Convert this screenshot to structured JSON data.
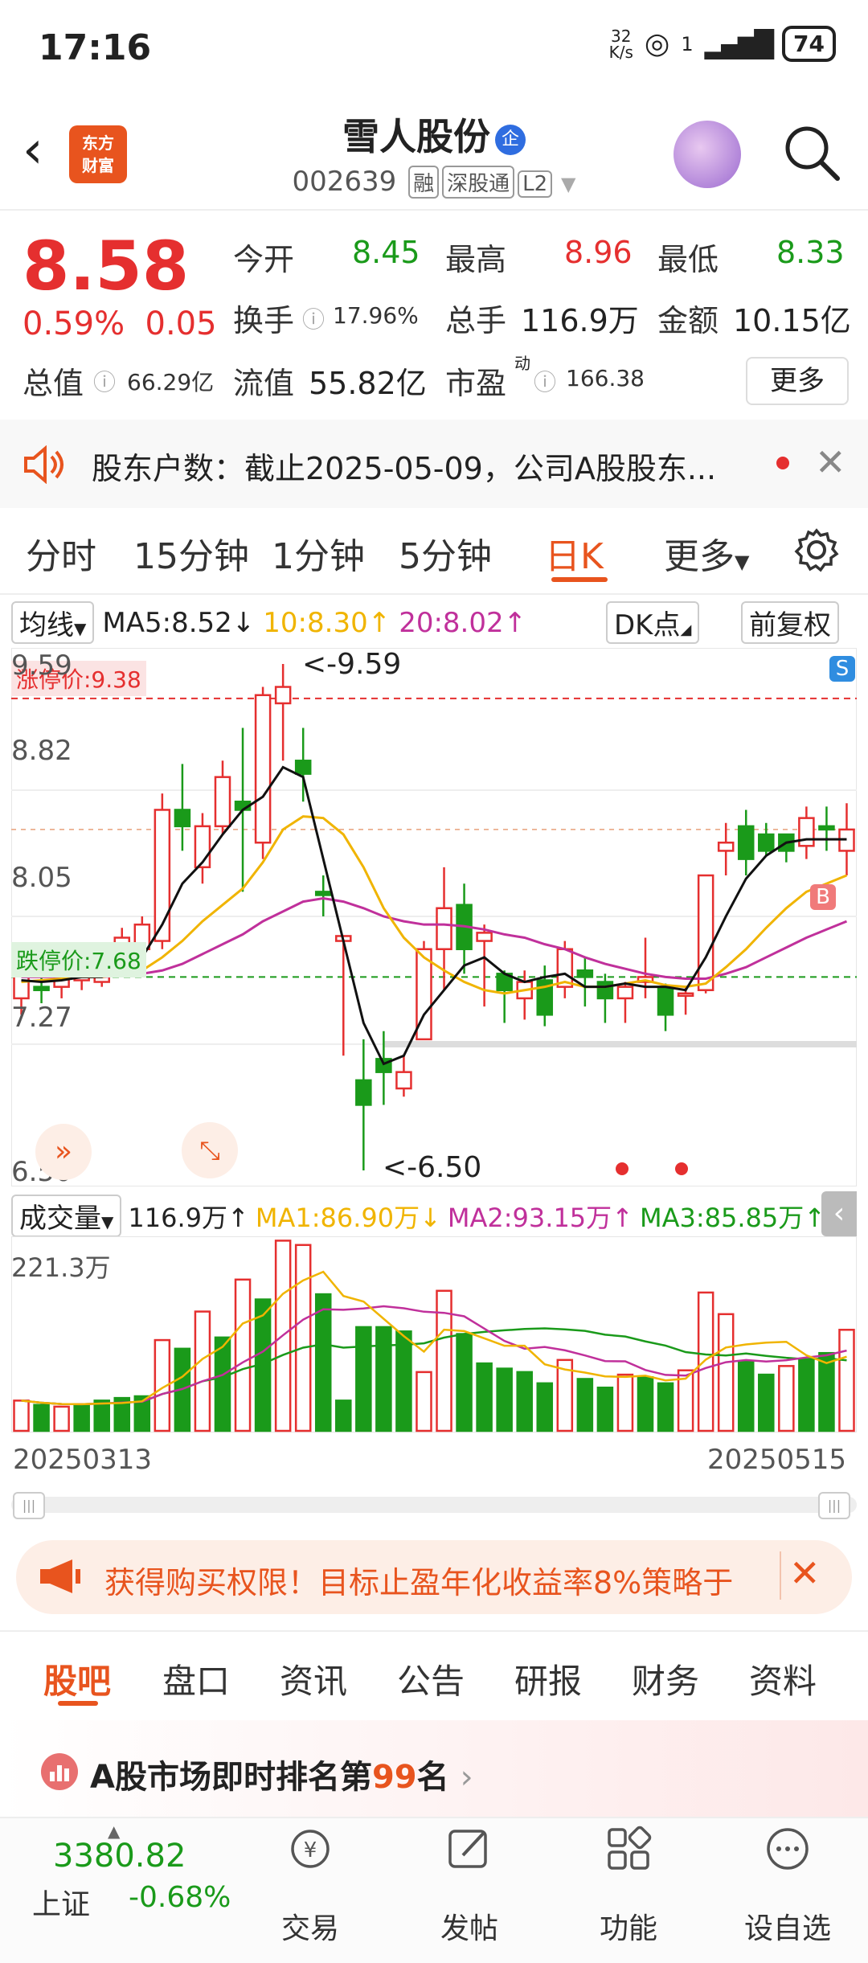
{
  "status_bar": {
    "time": "17:16",
    "net_speed": "32\nK/s",
    "signal_num": "1",
    "battery": "74"
  },
  "header": {
    "stock_name": "雪人股份",
    "badge": "企",
    "code": "002639",
    "tags": [
      "融",
      "深股通",
      "L2"
    ],
    "logo": "东方\n财富"
  },
  "quote": {
    "price": "8.58",
    "change_pct": "0.59%",
    "change_amt": "0.05",
    "open_label": "今开",
    "open": "8.45",
    "high_label": "最高",
    "high": "8.96",
    "low_label": "最低",
    "low": "8.33",
    "turnover_label": "换手",
    "turnover": "17.96%",
    "volume_label": "总手",
    "volume": "116.9万",
    "amount_label": "金额",
    "amount": "10.15亿",
    "mktcap_label": "总值",
    "mktcap": "66.29亿",
    "float_label": "流值",
    "float": "55.82亿",
    "pe_label": "市盈",
    "pe_sup": "动",
    "pe": "166.38",
    "more": "更多"
  },
  "notice": {
    "text": "股东户数：截止2025-05-09，公司A股股东..."
  },
  "chart_tabs": [
    "分时",
    "15分钟",
    "1分钟",
    "5分钟",
    "日K",
    "更多"
  ],
  "ma_row": {
    "selector": "均线",
    "ma5": "MA5:8.52",
    "ma10": "10:8.30",
    "ma20": "20:8.02",
    "dk": "DK点",
    "adjust": "前复权"
  },
  "kchart": {
    "limit_up_label": "涨停价:9.38",
    "limit_down_label": "跌停价:7.68",
    "hi_label": "<-9.59",
    "lo_label": "<-6.50",
    "y_labels": [
      "9.59",
      "8.82",
      "8.05",
      "7.27",
      "6.50"
    ],
    "s_mark": "S",
    "b_mark": "B"
  },
  "volume_row": {
    "selector": "成交量",
    "vol": "116.9万",
    "ma1": "MA1:86.90万",
    "ma2": "MA2:93.15万",
    "ma3": "MA3:85.85万",
    "max_label": "221.3万"
  },
  "dates": {
    "start": "20250313",
    "end": "20250515"
  },
  "promo": {
    "text": "获得购买权限！目标止盈年化收益率8%策略于"
  },
  "bottom_tabs": [
    "股吧",
    "盘口",
    "资讯",
    "公告",
    "研报",
    "财务",
    "资料"
  ],
  "rank": {
    "prefix": "A股市场即时排名第",
    "num": "99",
    "suffix": "名"
  },
  "index": {
    "value": "3380.82",
    "name": "上证",
    "change": "-0.68%"
  },
  "nav": [
    "交易",
    "发帖",
    "功能",
    "设自选"
  ],
  "chart_data": {
    "type": "candlestick",
    "ylim": [
      6.5,
      9.59
    ],
    "candles": [
      [
        7.55,
        7.75,
        7.45,
        7.68
      ],
      [
        7.62,
        7.6,
        7.52,
        7.7
      ],
      [
        7.62,
        7.7,
        7.55,
        7.72
      ],
      [
        7.66,
        7.72,
        7.6,
        7.76
      ],
      [
        7.65,
        7.75,
        7.62,
        7.8
      ],
      [
        7.78,
        7.92,
        7.7,
        7.98
      ],
      [
        7.85,
        8.0,
        7.72,
        8.05
      ],
      [
        7.9,
        8.7,
        7.85,
        8.8
      ],
      [
        8.7,
        8.6,
        8.45,
        8.98
      ],
      [
        8.35,
        8.6,
        8.25,
        8.68
      ],
      [
        8.6,
        8.9,
        8.55,
        9.0
      ],
      [
        8.75,
        8.7,
        8.2,
        9.2
      ],
      [
        8.5,
        9.4,
        8.4,
        9.45
      ],
      [
        9.35,
        9.45,
        9.0,
        9.59
      ],
      [
        9.0,
        8.92,
        8.75,
        9.2
      ],
      [
        8.2,
        8.18,
        8.05,
        8.3
      ],
      [
        7.9,
        7.93,
        7.2,
        7.92
      ],
      [
        7.05,
        6.9,
        6.5,
        7.3
      ],
      [
        7.18,
        7.1,
        6.9,
        7.35
      ],
      [
        7.0,
        7.1,
        6.95,
        7.2
      ],
      [
        7.3,
        7.85,
        7.3,
        7.9
      ],
      [
        7.85,
        8.1,
        7.6,
        8.35
      ],
      [
        8.12,
        7.85,
        7.7,
        8.25
      ],
      [
        7.9,
        7.95,
        7.5,
        8.0
      ],
      [
        7.7,
        7.6,
        7.4,
        7.72
      ],
      [
        7.55,
        7.65,
        7.42,
        7.72
      ],
      [
        7.66,
        7.45,
        7.38,
        7.75
      ],
      [
        7.62,
        7.85,
        7.55,
        7.9
      ],
      [
        7.72,
        7.68,
        7.5,
        7.8
      ],
      [
        7.65,
        7.55,
        7.4,
        7.7
      ],
      [
        7.55,
        7.62,
        7.4,
        7.65
      ],
      [
        7.65,
        7.68,
        7.55,
        7.92
      ],
      [
        7.62,
        7.45,
        7.35,
        7.64
      ],
      [
        7.58,
        7.58,
        7.45,
        7.62
      ],
      [
        7.6,
        8.3,
        7.58,
        8.3
      ],
      [
        8.45,
        8.5,
        8.3,
        8.62
      ],
      [
        8.6,
        8.4,
        8.3,
        8.7
      ],
      [
        8.55,
        8.45,
        8.42,
        8.62
      ],
      [
        8.55,
        8.45,
        8.38,
        8.55
      ],
      [
        8.48,
        8.65,
        8.4,
        8.72
      ],
      [
        8.6,
        8.58,
        8.45,
        8.72
      ],
      [
        8.45,
        8.58,
        8.3,
        8.74
      ]
    ],
    "ma5": [
      7.66,
      7.65,
      7.66,
      7.68,
      7.68,
      7.74,
      7.8,
      8.0,
      8.25,
      8.38,
      8.55,
      8.7,
      8.78,
      8.96,
      8.9,
      8.4,
      7.9,
      7.4,
      7.15,
      7.2,
      7.45,
      7.6,
      7.75,
      7.8,
      7.7,
      7.65,
      7.68,
      7.7,
      7.62,
      7.62,
      7.64,
      7.62,
      7.62,
      7.6,
      7.8,
      8.05,
      8.28,
      8.42,
      8.5,
      8.52,
      8.52,
      8.52
    ],
    "ma10": [
      7.65,
      7.66,
      7.67,
      7.68,
      7.68,
      7.7,
      7.72,
      7.8,
      7.9,
      8.02,
      8.12,
      8.22,
      8.38,
      8.58,
      8.66,
      8.65,
      8.55,
      8.35,
      8.1,
      7.92,
      7.8,
      7.72,
      7.65,
      7.6,
      7.58,
      7.6,
      7.62,
      7.65,
      7.62,
      7.62,
      7.64,
      7.66,
      7.63,
      7.62,
      7.64,
      7.74,
      7.85,
      7.98,
      8.1,
      8.2,
      8.25,
      8.3
    ],
    "ma20": [
      7.68,
      7.68,
      7.68,
      7.68,
      7.68,
      7.69,
      7.7,
      7.72,
      7.76,
      7.82,
      7.88,
      7.94,
      8.02,
      8.08,
      8.14,
      8.16,
      8.14,
      8.1,
      8.05,
      8.02,
      8.0,
      8.0,
      7.99,
      7.97,
      7.94,
      7.92,
      7.88,
      7.85,
      7.8,
      7.76,
      7.73,
      7.7,
      7.68,
      7.67,
      7.67,
      7.7,
      7.74,
      7.8,
      7.86,
      7.92,
      7.97,
      8.02
    ],
    "volume_max": 221.3,
    "volumes": [
      35,
      30,
      28,
      30,
      35,
      38,
      40,
      105,
      95,
      138,
      108,
      175,
      152,
      220,
      215,
      158,
      35,
      120,
      120,
      115,
      68,
      162,
      112,
      78,
      72,
      68,
      55,
      82,
      60,
      50,
      65,
      62,
      55,
      70,
      160,
      135,
      80,
      65,
      75,
      82,
      90,
      116.9
    ],
    "vol_up": [
      true,
      false,
      true,
      false,
      false,
      false,
      false,
      true,
      false,
      true,
      false,
      true,
      false,
      true,
      true,
      false,
      false,
      false,
      false,
      false,
      true,
      true,
      false,
      false,
      false,
      false,
      false,
      true,
      false,
      false,
      true,
      false,
      false,
      true,
      true,
      true,
      false,
      false,
      true,
      false,
      false,
      true
    ]
  }
}
